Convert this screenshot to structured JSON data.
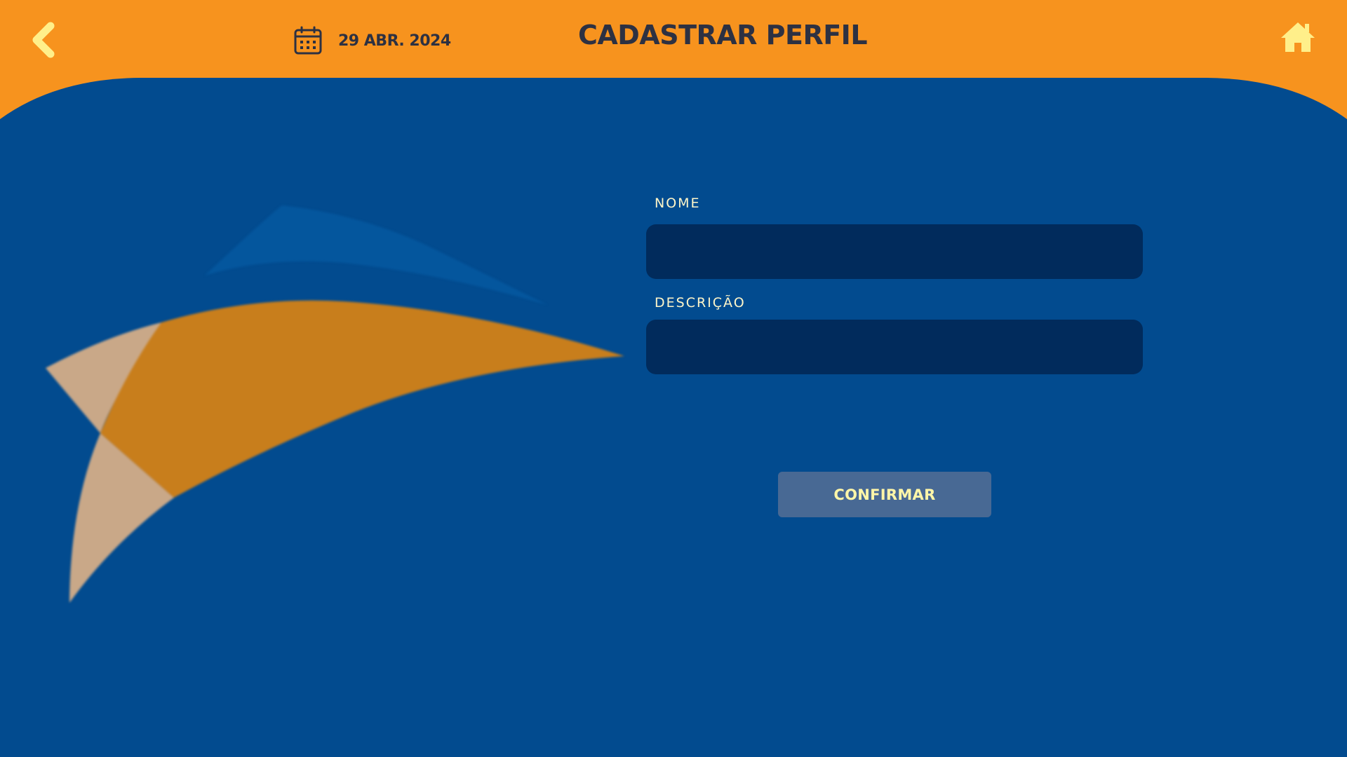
{
  "header": {
    "back_icon": "chevron-left-icon",
    "calendar_icon": "calendar-icon",
    "date": "29 ABR. 2024",
    "title": "CADASTRAR PERFIL",
    "home_icon": "home-icon"
  },
  "form": {
    "name_label": "NOME",
    "name_value": "",
    "description_label": "DESCRIÇÃO",
    "description_value": "",
    "confirm_label": "CONFIRMAR"
  },
  "colors": {
    "header_orange": "#f7931e",
    "background_blue": "#024b8f",
    "input_navy": "#012b5c",
    "button_slate": "#486994",
    "accent_yellow": "#ffef8a",
    "title_dark": "#2d3142"
  }
}
